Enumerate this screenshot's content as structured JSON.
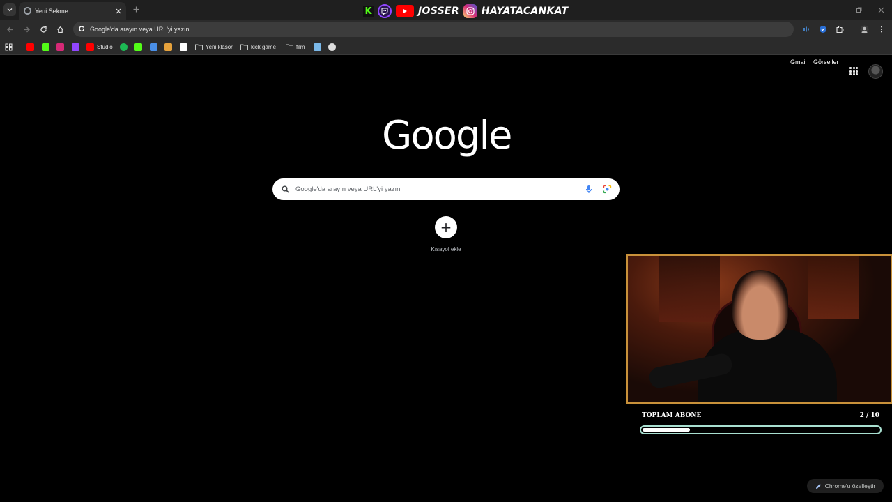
{
  "browser": {
    "tab": {
      "title": "Yeni Sekme"
    },
    "omnibox": {
      "text": "Google'da arayın veya URL'yi yazın"
    }
  },
  "stream_overlay": {
    "handle_1": "JOSSER",
    "handle_2": "HAYATACANKAT"
  },
  "bookmarks": [
    {
      "label": "",
      "icon": "youtube-icon",
      "color": "#ff0000"
    },
    {
      "label": "",
      "icon": "kick-icon",
      "color": "#53fc18"
    },
    {
      "label": "",
      "icon": "instagram-icon",
      "color": "#d62976"
    },
    {
      "label": "",
      "icon": "twitch-icon",
      "color": "#9146ff"
    },
    {
      "label": "Studio",
      "icon": "youtube-studio-icon",
      "color": "#ff0000"
    },
    {
      "label": "",
      "icon": "spotify-icon",
      "color": "#1db954"
    },
    {
      "label": "",
      "icon": "kick-icon",
      "color": "#53fc18"
    },
    {
      "label": "",
      "icon": "app-icon",
      "color": "#4a8fe7"
    },
    {
      "label": "",
      "icon": "app-icon",
      "color": "#e6a23c"
    },
    {
      "label": "",
      "icon": "diamond-icon",
      "color": "#ffffff"
    },
    {
      "label": "Yeni klasör",
      "icon": "folder-icon",
      "color": "#c4c7c5"
    },
    {
      "label": "kick game",
      "icon": "folder-icon",
      "color": "#c4c7c5"
    },
    {
      "label": "film",
      "icon": "folder-icon",
      "color": "#c4c7c5"
    },
    {
      "label": "",
      "icon": "image-icon",
      "color": "#7ab8e8"
    },
    {
      "label": "",
      "icon": "globe-icon",
      "color": "#dddddd"
    }
  ],
  "google": {
    "gmail": "Gmail",
    "images": "Görseller",
    "logo": "Google",
    "search_placeholder": "Google'da arayın veya URL'yi yazın",
    "shortcut_label": "Kısayol ekle",
    "customize": "Chrome'u özelleştir"
  },
  "subscriber_goal": {
    "title": "TOPLAM ABONE",
    "count": "2 / 10",
    "current": 2,
    "target": 10
  },
  "colors": {
    "goal_border": "#a8dfd0",
    "webcam_border": "#c8913a"
  }
}
